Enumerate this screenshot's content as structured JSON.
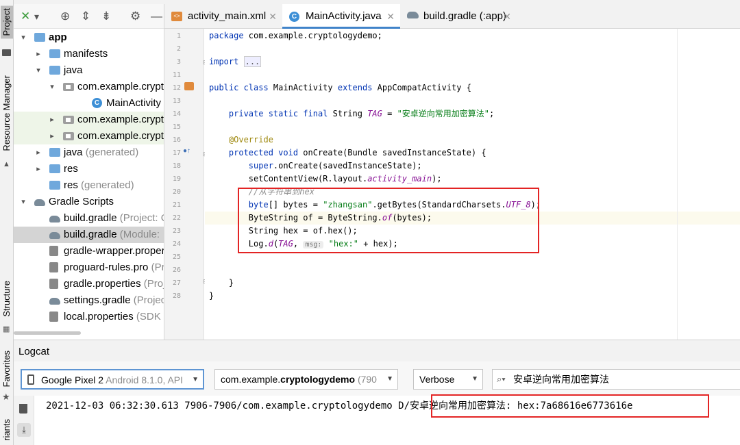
{
  "strip": {
    "project": "Project",
    "resource_manager": "Resource Manager",
    "structure": "Structure",
    "favorites": "Favorites",
    "variants": "riants"
  },
  "tree": [
    {
      "arrow": "▾",
      "icon": "folder",
      "label": "app",
      "bold": true
    },
    {
      "arrow": "▸",
      "icon": "folder",
      "label": "manifests"
    },
    {
      "arrow": "▾",
      "icon": "folder",
      "label": "java"
    },
    {
      "arrow": "▾",
      "icon": "pkg",
      "label": "com.example.crypto"
    },
    {
      "arrow": "",
      "icon": "cls",
      "label": "MainActivity"
    },
    {
      "arrow": "▸",
      "icon": "pkg",
      "label": "com.example.crypto"
    },
    {
      "arrow": "▸",
      "icon": "pkg",
      "label": "com.example.crypto"
    },
    {
      "arrow": "▸",
      "icon": "folder",
      "label": "java",
      "suffix": " (generated)"
    },
    {
      "arrow": "▸",
      "icon": "folder",
      "label": "res"
    },
    {
      "arrow": "",
      "icon": "folder",
      "label": "res",
      "suffix": " (generated)"
    },
    {
      "arrow": "▾",
      "icon": "gradle",
      "label": "Gradle Scripts"
    },
    {
      "arrow": "",
      "icon": "gradle",
      "label": "build.gradle",
      "suffix": " (Project: C"
    },
    {
      "arrow": "",
      "icon": "gradle",
      "label": "build.gradle",
      "suffix": " (Module: "
    },
    {
      "arrow": "",
      "icon": "file",
      "label": "gradle-wrapper.proper"
    },
    {
      "arrow": "",
      "icon": "file",
      "label": "proguard-rules.pro",
      "suffix": " (Pr"
    },
    {
      "arrow": "",
      "icon": "file",
      "label": "gradle.properties",
      "suffix": " (Proj"
    },
    {
      "arrow": "",
      "icon": "gradle",
      "label": "settings.gradle",
      "suffix": " (Project"
    },
    {
      "arrow": "",
      "icon": "file",
      "label": "local.properties",
      "suffix": " (SDK L"
    }
  ],
  "tabs": [
    {
      "label": "activity_main.xml",
      "icon": "xml",
      "active": false
    },
    {
      "label": "MainActivity.java",
      "icon": "C",
      "active": true
    },
    {
      "label": "build.gradle (:app)",
      "icon": "gradle",
      "active": false
    }
  ],
  "line_numbers": [
    "1",
    "2",
    "3",
    "11",
    "12",
    "13",
    "14",
    "15",
    "16",
    "17",
    "18",
    "19",
    "20",
    "21",
    "22",
    "23",
    "24",
    "25",
    "26",
    "27",
    "28"
  ],
  "code": {
    "l1_pkg": "package",
    "l1_rest": " com.example.cryptologydemo;",
    "l3_import": "import",
    "l3_fold": "...",
    "l12_a": "public class",
    "l12_b": " MainActivity ",
    "l12_c": "extends",
    "l12_d": " AppCompatActivity {",
    "l14_a": "    private static final",
    "l14_b": " String ",
    "l14_c": "TAG",
    "l14_d": " = ",
    "l14_e": "\"安卓逆向常用加密算法\"",
    "l14_f": ";",
    "l16": "    @Override",
    "l17_a": "    protected void",
    "l17_b": " onCreate(Bundle savedInstanceState) {",
    "l18_a": "        super",
    "l18_b": ".onCreate(savedInstanceState);",
    "l19_a": "        setContentView(R.layout.",
    "l19_b": "activity_main",
    "l19_c": ");",
    "l20": "        //从字符串到hex",
    "l21_a": "        byte",
    "l21_b": "[] bytes = ",
    "l21_c": "\"zhangsan\"",
    "l21_d": ".getBytes(StandardCharsets.",
    "l21_e": "UTF_8",
    "l21_f": ");",
    "l22_a": "        ByteString of = ByteString.",
    "l22_b": "of",
    "l22_c": "(bytes);",
    "l23": "        String hex = of.hex();",
    "l24_a": "        Log.",
    "l24_b": "d",
    "l24_c": "(",
    "l24_d": "TAG",
    "l24_e": ", ",
    "l24_hint": "msg:",
    "l24_f": " ",
    "l24_g": "\"hex:\"",
    "l24_h": " + hex);",
    "l27": "    }",
    "l28": "}"
  },
  "logcat": {
    "title": "Logcat",
    "device": "Google Pixel 2",
    "device_suffix": " Android 8.1.0, API",
    "package_prefix": "com.example.",
    "package_bold": "cryptologydemo",
    "package_suffix": " (790",
    "level": "Verbose",
    "search": "安卓逆向常用加密算法",
    "line": "2021-12-03 06:32:30.613 7906-7906/com.example.cryptologydemo D/安卓逆向常用加密算法: hex:7a68616e6773616e"
  }
}
